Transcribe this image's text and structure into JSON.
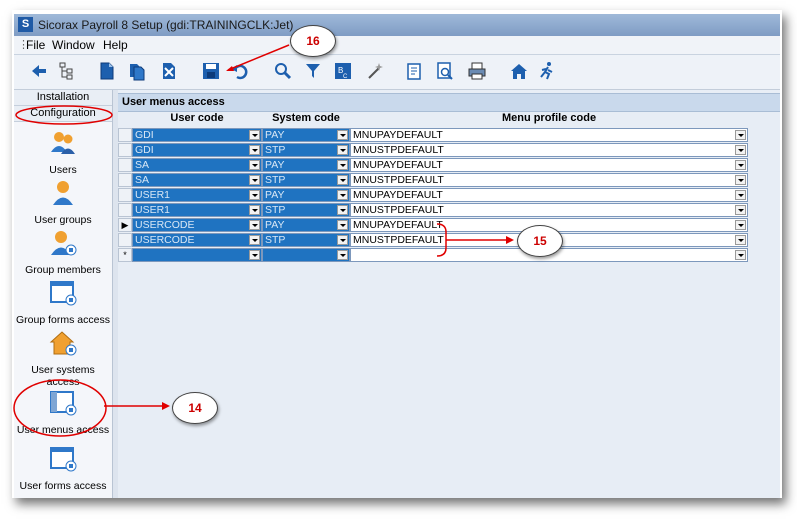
{
  "window": {
    "title": "Sicorax Payroll 8 Setup (gdi:TRAININGCLK:Jet)",
    "app_icon": "S"
  },
  "menubar": {
    "items": [
      "File",
      "Window",
      "Help"
    ]
  },
  "toolbar": {
    "icons": [
      "back-icon",
      "tree-icon",
      "new-doc-icon",
      "copy-doc-icon",
      "delete-doc-icon",
      "save-icon",
      "undo-icon",
      "search-icon",
      "filter-icon",
      "abc-icon",
      "wand-icon",
      "report-icon",
      "preview-icon",
      "print-icon",
      "home-icon",
      "exit-icon"
    ]
  },
  "sidebar": {
    "tabs": [
      "Installation",
      "Configuration"
    ],
    "items": [
      {
        "label": "Users",
        "icon": "users-icon"
      },
      {
        "label": "User groups",
        "icon": "user-groups-icon"
      },
      {
        "label": "Group members",
        "icon": "group-members-icon"
      },
      {
        "label": "Group forms access",
        "icon": "group-forms-access-icon"
      },
      {
        "label": "User systems access",
        "icon": "user-systems-access-icon"
      },
      {
        "label": "User menus access",
        "icon": "user-menus-access-icon"
      },
      {
        "label": "User forms access",
        "icon": "user-forms-access-icon"
      }
    ]
  },
  "panel": {
    "title": "User menus access",
    "columns": [
      "User code",
      "System code",
      "Menu profile code"
    ],
    "rows": [
      {
        "user": "GDI",
        "system": "PAY",
        "menu": "MNUPAYDEFAULT"
      },
      {
        "user": "GDI",
        "system": "STP",
        "menu": "MNUSTPDEFAULT"
      },
      {
        "user": "SA",
        "system": "PAY",
        "menu": "MNUPAYDEFAULT"
      },
      {
        "user": "SA",
        "system": "STP",
        "menu": "MNUSTPDEFAULT"
      },
      {
        "user": "USER1",
        "system": "PAY",
        "menu": "MNUPAYDEFAULT"
      },
      {
        "user": "USER1",
        "system": "STP",
        "menu": "MNUSTPDEFAULT"
      },
      {
        "user": "USERCODE",
        "system": "PAY",
        "menu": "MNUPAYDEFAULT"
      },
      {
        "user": "USERCODE",
        "system": "STP",
        "menu": "MNUSTPDEFAULT"
      },
      {
        "user": "",
        "system": "",
        "menu": ""
      }
    ],
    "current_row_marker": "▶",
    "new_row_marker": "*"
  },
  "callouts": [
    "16",
    "15",
    "14"
  ],
  "colors": {
    "cell_blue": "#1f73c1",
    "callout_red": "#e00000",
    "header_blue": "#c9d9ec"
  }
}
